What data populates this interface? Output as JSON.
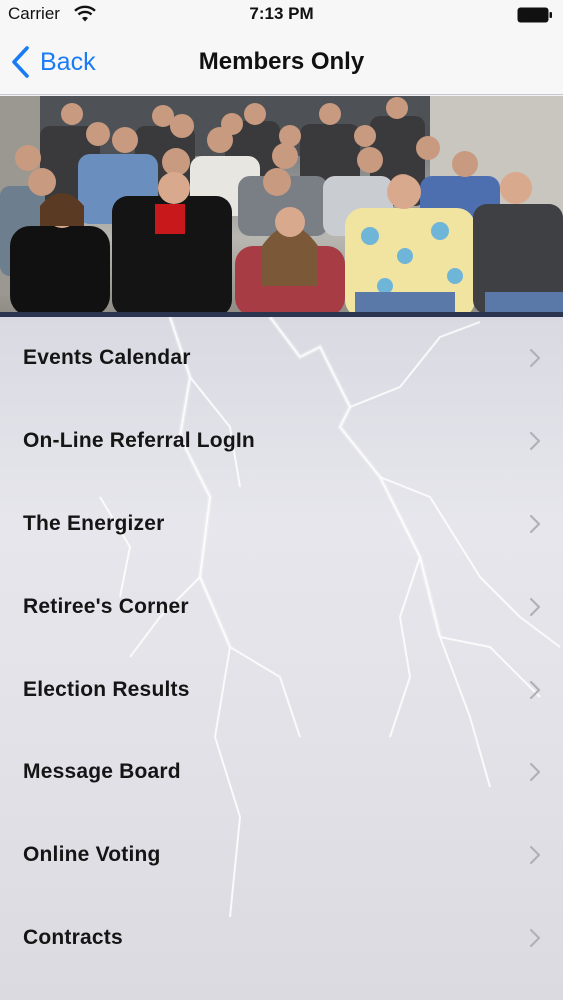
{
  "status_bar": {
    "carrier": "Carrier",
    "time": "7:13 PM"
  },
  "nav": {
    "back_label": "Back",
    "title": "Members Only"
  },
  "menu": {
    "items": [
      {
        "label": "Events Calendar"
      },
      {
        "label": "On-Line Referral LogIn"
      },
      {
        "label": "The Energizer"
      },
      {
        "label": "Retiree's Corner"
      },
      {
        "label": "Election Results"
      },
      {
        "label": "Message Board"
      },
      {
        "label": "Online Voting"
      },
      {
        "label": "Contracts"
      }
    ]
  },
  "colors": {
    "accent": "#1a7cf5",
    "chevron": "#b0b0b8",
    "label": "#151515"
  },
  "icons": {
    "back": "chevron-left-icon",
    "row": "chevron-right-icon",
    "wifi": "wifi-icon",
    "battery": "battery-icon"
  }
}
